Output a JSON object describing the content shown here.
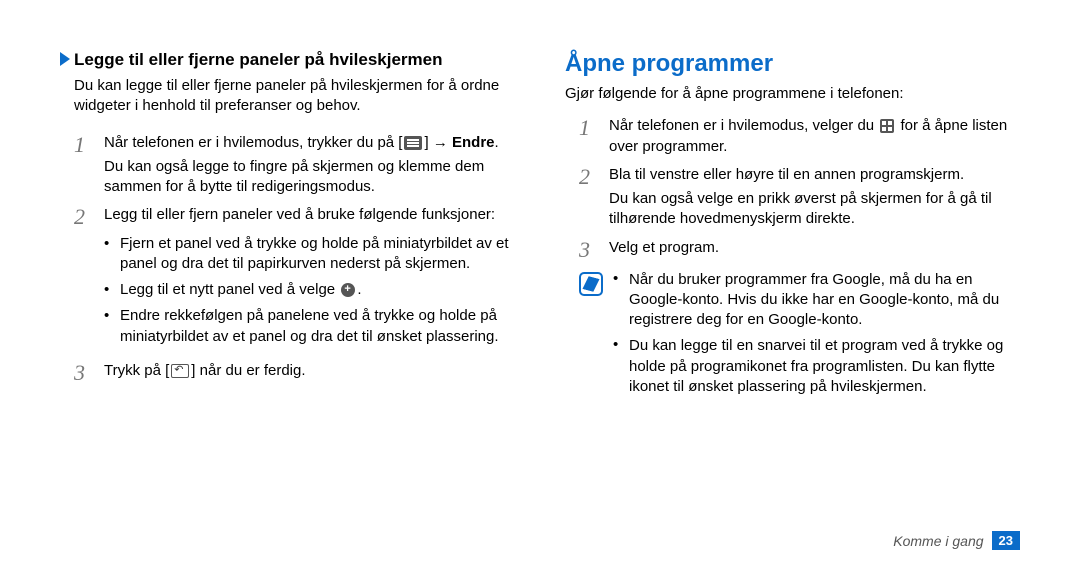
{
  "left": {
    "heading": "Legge til eller fjerne paneler på hvileskjermen",
    "intro": "Du kan legge til eller fjerne paneler på hvileskjermen for å ordne widgeter i henhold til preferanser og behov.",
    "step1_prefix": "Når telefonen er i hvilemodus, trykker du på [",
    "step1_suffix": "] → ",
    "step1_bold": "Endre",
    "step1_period": ".",
    "step1_extra": "Du kan også legge to fingre på skjermen og klemme dem sammen for å bytte til redigeringsmodus.",
    "step2_intro": "Legg til eller fjern paneler ved å bruke følgende funksjoner:",
    "step2_b1": "Fjern et panel ved å trykke og holde på miniatyrbildet av et panel og dra det til papirkurven nederst på skjermen.",
    "step2_b2_prefix": "Legg til et nytt panel ved å velge ",
    "step2_b2_suffix": ".",
    "step2_b3": "Endre rekkefølgen på panelene ved å trykke og holde på miniatyrbildet av et panel og dra det til ønsket plassering.",
    "step3_prefix": "Trykk på [",
    "step3_suffix": "] når du er ferdig."
  },
  "right": {
    "main_heading": "Åpne programmer",
    "intro": "Gjør følgende for å åpne programmene i telefonen:",
    "step1_prefix": "Når telefonen er i hvilemodus, velger du ",
    "step1_suffix": " for å åpne listen over programmer.",
    "step2": "Bla til venstre eller høyre til en annen programskjerm.",
    "step2_extra": "Du kan også velge en prikk øverst på skjermen for å gå til tilhørende hovedmenyskjerm direkte.",
    "step3": "Velg et program.",
    "note_b1": "Når du bruker programmer fra Google, må du ha en Google-konto. Hvis du ikke har en Google-konto, må du registrere deg for en Google-konto.",
    "note_b2": "Du kan legge til en snarvei til et program ved å trykke og holde på programikonet fra programlisten. Du kan flytte ikonet til ønsket plassering på hvileskjermen."
  },
  "footer": {
    "section": "Komme i gang",
    "page": "23"
  }
}
